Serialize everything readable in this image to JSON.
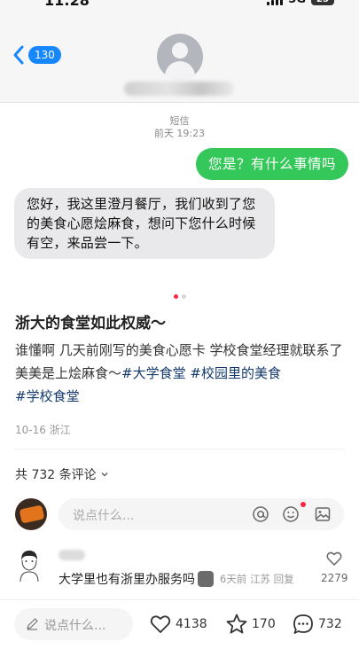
{
  "screenshot": {
    "status_time": "11:28",
    "network": "5G",
    "battery": "25",
    "back_badge": "130",
    "sms_label": "短信",
    "sms_time": "前天 19:23",
    "sent_message": "您是？有什么事情吗",
    "received_message": "您好，我这里澄月餐厅，我们收到了您的美食心愿烩麻食，想问下您什么时候有空，来品尝一下。"
  },
  "carousel": {
    "total": 2,
    "active": 1
  },
  "post": {
    "title": "浙大的食堂如此权威～",
    "body_text": "谁懂啊 几天前刚写的美食心愿卡 学校食堂经理就联系了 美美是上烩麻食～",
    "tags": [
      "#大学食堂",
      "#校园里的美食",
      "#学校食堂"
    ],
    "date_location": "10-16 浙江"
  },
  "comments": {
    "count_label": "共 732 条评论",
    "input_placeholder": "说点什么...",
    "items": [
      {
        "text": "大学里也有浙里办服务吗",
        "time": "6天前",
        "location": "江苏",
        "reply_label": "回复",
        "likes": "2279"
      }
    ]
  },
  "bottom_bar": {
    "input_placeholder": "说点什么...",
    "likes": "4138",
    "favorites": "170",
    "comments": "732"
  },
  "colors": {
    "accent_red": "#ff2442",
    "imessage_green": "#34c759",
    "ios_blue": "#1787ff",
    "tag_blue": "#13386c"
  }
}
